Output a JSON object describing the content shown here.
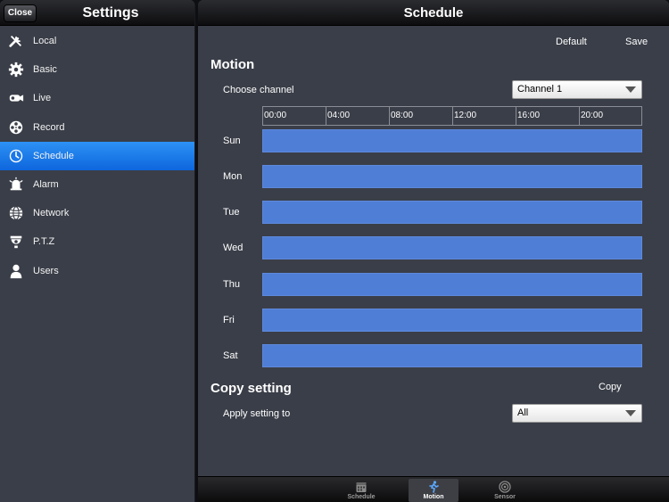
{
  "settings": {
    "title": "Settings",
    "close_label": "Close",
    "menu": [
      {
        "label": "Local",
        "icon": "tools-icon"
      },
      {
        "label": "Basic",
        "icon": "gear-icon"
      },
      {
        "label": "Live",
        "icon": "camera-icon"
      },
      {
        "label": "Record",
        "icon": "film-reel-icon"
      },
      {
        "label": "Schedule",
        "icon": "clock-icon",
        "active": true
      },
      {
        "label": "Alarm",
        "icon": "alarm-bell-icon"
      },
      {
        "label": "Network",
        "icon": "globe-icon"
      },
      {
        "label": "P.T.Z",
        "icon": "dome-camera-icon"
      },
      {
        "label": "Users",
        "icon": "user-icon"
      }
    ]
  },
  "schedule": {
    "title": "Schedule",
    "default_label": "Default",
    "save_label": "Save",
    "motion": {
      "title": "Motion",
      "choose_channel_label": "Choose channel",
      "channel_value": "Channel 1",
      "time_ticks": [
        "00:00",
        "04:00",
        "08:00",
        "12:00",
        "16:00",
        "20:00"
      ],
      "days": [
        "Sun",
        "Mon",
        "Tue",
        "Wed",
        "Thu",
        "Fri",
        "Sat"
      ]
    },
    "copy": {
      "title": "Copy setting",
      "copy_label": "Copy",
      "apply_label": "Apply setting to",
      "apply_value": "All"
    }
  },
  "tabs": [
    {
      "label": "Schedule",
      "icon": "calendar-icon"
    },
    {
      "label": "Motion",
      "icon": "running-person-icon",
      "selected": true
    },
    {
      "label": "Sensor",
      "icon": "sensor-icon"
    }
  ],
  "colors": {
    "accent_blue": "#1a78ea",
    "schedule_bar": "#4f7ed6",
    "panel_bg": "#3a3e48"
  }
}
